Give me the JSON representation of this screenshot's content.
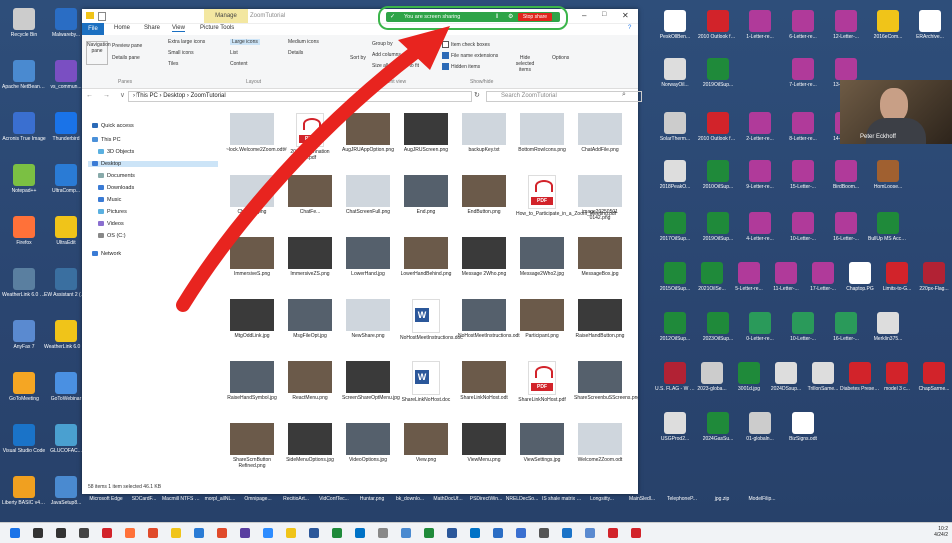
{
  "sharing": {
    "label": "You are screen sharing",
    "stop_label": "Stop share",
    "accent": "#2ea447",
    "stop_color": "#e1261c"
  },
  "webcam": {
    "name": "Peter Eckhoff"
  },
  "explorer": {
    "title": "ZoomTutorial",
    "manage_tab": "Manage",
    "tabs": [
      "File",
      "Home",
      "Share",
      "View",
      "Picture Tools"
    ],
    "ribbon": {
      "panes_items": [
        "Preview pane",
        "Details pane"
      ],
      "nav_pane": "Navigation pane",
      "layout_items": [
        "Extra large icons",
        "Large icons",
        "Medium icons",
        "Small icons",
        "List",
        "Details",
        "Tiles",
        "Content"
      ],
      "sort_by": "Sort by",
      "current_view_items": [
        "Group by",
        "Add columns",
        "Size all columns to fit"
      ],
      "checkboxes": [
        {
          "label": "Item check boxes",
          "checked": false
        },
        {
          "label": "File name extensions",
          "checked": true
        },
        {
          "label": "Hidden items",
          "checked": true
        }
      ],
      "hide_selected": "Hide selected items",
      "options": "Options",
      "groups": [
        "Panes",
        "Layout",
        "Current view",
        "Show/hide"
      ]
    },
    "address": "› This PC › Desktop › ZoomTutorial",
    "search_placeholder": "Search ZoomTutorial",
    "nav": [
      {
        "label": "Quick access",
        "color": "#2b6ab7"
      },
      {
        "label": "This PC",
        "color": "#4a90d9"
      },
      {
        "label": "3D Objects",
        "color": "#5ab0e0"
      },
      {
        "label": "Desktop",
        "color": "#3a7bd5",
        "selected": true
      },
      {
        "label": "Documents",
        "color": "#8aa"
      },
      {
        "label": "Downloads",
        "color": "#3a7bd5"
      },
      {
        "label": "Music",
        "color": "#3a7bd5"
      },
      {
        "label": "Pictures",
        "color": "#5ab0e0"
      },
      {
        "label": "Videos",
        "color": "#8a6fd0"
      },
      {
        "label": "OS (C:)",
        "color": "#888"
      },
      {
        "label": "Network",
        "color": "#3a7bd5"
      }
    ],
    "files": [
      {
        "name": "~lock.Welcome2Zoom.odt#",
        "kind": "light"
      },
      {
        "name": "2000-Zoomnation al.pdf",
        "kind": "pdf"
      },
      {
        "name": "AugJRUAppOption.png",
        "kind": "img"
      },
      {
        "name": "AugJRUScreen.png",
        "kind": "img"
      },
      {
        "name": "backupKey.txt",
        "kind": "light"
      },
      {
        "name": "BottomRowIcons.png",
        "kind": "light"
      },
      {
        "name": "ChatAddFile.png",
        "kind": "light"
      },
      {
        "name": "ChatBox.png",
        "kind": "light"
      },
      {
        "name": "ChatFe...",
        "kind": "img"
      },
      {
        "name": "ChatScreenFull.png",
        "kind": "light"
      },
      {
        "name": "End.png",
        "kind": "img"
      },
      {
        "name": "EndButton.png",
        "kind": "img"
      },
      {
        "name": "How_to_Participate_in_a_Zoom_Meeting.pdf",
        "kind": "pdf"
      },
      {
        "name": "image20250501 0142.png",
        "kind": "light"
      },
      {
        "name": "ImmersiveS.png",
        "kind": "img"
      },
      {
        "name": "ImmersiveZS.png",
        "kind": "img"
      },
      {
        "name": "LowerHand.jpg",
        "kind": "img"
      },
      {
        "name": "LowerHandBehind.png",
        "kind": "img"
      },
      {
        "name": "Message 2Who.png",
        "kind": "img"
      },
      {
        "name": "Message2Who2.jpg",
        "kind": "img"
      },
      {
        "name": "MessageBox.jpg",
        "kind": "img"
      },
      {
        "name": "MtgOddLink.jpg",
        "kind": "img"
      },
      {
        "name": "MsgFileOpt.jpg",
        "kind": "img"
      },
      {
        "name": "NewShare.png",
        "kind": "light"
      },
      {
        "name": "NoHostMeetInstructions.doc",
        "kind": "doc"
      },
      {
        "name": "NoHostMeetInstructions.odt",
        "kind": "img"
      },
      {
        "name": "Participant.png",
        "kind": "img"
      },
      {
        "name": "RaiseHandButton.png",
        "kind": "img"
      },
      {
        "name": "RaiseHandSymbol.jpg",
        "kind": "img"
      },
      {
        "name": "ReactMenu.png",
        "kind": "img"
      },
      {
        "name": "ScreenShareOptMenu.jpg",
        "kind": "img"
      },
      {
        "name": "ShareLinkNoHost.doc",
        "kind": "doc"
      },
      {
        "name": "ShareLinkNoHost.odt",
        "kind": "img"
      },
      {
        "name": "ShareLinkNoHost.pdf",
        "kind": "pdf"
      },
      {
        "name": "ShareScreenbuSScreens.png",
        "kind": "img"
      },
      {
        "name": "ShareScrnButton Refined.png",
        "kind": "img"
      },
      {
        "name": "SideMenuOptions.jpg",
        "kind": "img"
      },
      {
        "name": "VideoOptions.jpg",
        "kind": "img"
      },
      {
        "name": "View.png",
        "kind": "img"
      },
      {
        "name": "ViewMenu.png",
        "kind": "img"
      },
      {
        "name": "ViewSettings.jpg",
        "kind": "img"
      },
      {
        "name": "Welcome2Zoom.odt",
        "kind": "light"
      }
    ],
    "status": "58 items   1 item selected  46.1 KB"
  },
  "desktop_left": [
    {
      "label": "Recycle Bin",
      "color": "#ccc"
    },
    {
      "label": "Malwareby...",
      "color": "#2a6dc4"
    },
    {
      "label": "Apache NetBeans I...",
      "color": "#4a8ad0"
    },
    {
      "label": "vs_commun...",
      "color": "#7a4fc2"
    },
    {
      "label": "Acronis True Image",
      "color": "#3a6fd0"
    },
    {
      "label": "Thunderbird",
      "color": "#1a73e8"
    },
    {
      "label": "Notepad++",
      "color": "#7bc043"
    },
    {
      "label": "UltraComp...",
      "color": "#2a7bd5"
    },
    {
      "label": "Firefox",
      "color": "#ff7139"
    },
    {
      "label": "UltraEdit",
      "color": "#f0c419"
    },
    {
      "label": "WeatherLink 6.0 Lance",
      "color": "#5a7fa0"
    },
    {
      "label": "EW Assistant 2 (Lenovo...",
      "color": "#3a6fa0"
    },
    {
      "label": "AnyFax 7",
      "color": "#5a8ad0"
    },
    {
      "label": "WeatherLink 6.0 Dutton",
      "color": "#f0c419"
    },
    {
      "label": "GoToMeeting",
      "color": "#f5a623"
    },
    {
      "label": "GoToWebinar",
      "color": "#4a90e2"
    },
    {
      "label": "Visual Studio Code",
      "color": "#1a73c8"
    },
    {
      "label": "GLUCOFAC...",
      "color": "#4aa0d0"
    },
    {
      "label": "Liberty BASIC v4.5.1",
      "color": "#f0a020"
    },
    {
      "label": "JavaSetup8...",
      "color": "#4a8ad0"
    }
  ],
  "desktop_bottom": [
    "Microsoft Edge",
    "SDCardF...",
    "Macmill NTFS To...",
    "morpl_allNL...",
    "Omnipage...",
    "RecitioArt...",
    "VidConfTec...",
    "Huntar.png",
    "bk_downlo...",
    "MathDocUf...",
    "PSDirectWin...",
    "NRELDecSo...",
    "IS shale matrix 1.jpg",
    "Longsitty...",
    "MainSledl...",
    "TelephoneP...",
    "jpg.zip",
    "ModelFilip..."
  ],
  "desktop_right": [
    {
      "label": "PeskOllBen...",
      "color": "#fff"
    },
    {
      "label": "2010 Outlook for Energy...",
      "color": "#d2232a"
    },
    {
      "label": "1-Letter-re...",
      "color": "#b03a9a"
    },
    {
      "label": "6-Letter-re...",
      "color": "#b03a9a"
    },
    {
      "label": "12-Letter-...",
      "color": "#b03a9a"
    },
    {
      "label": "2016eCom...",
      "color": "#f0c419"
    },
    {
      "label": "ERArchive...",
      "color": "#fff"
    },
    {
      "label": "NorwayOil...",
      "color": "#ddd"
    },
    {
      "label": "2019OilSup...",
      "color": "#1f8a3a"
    },
    {
      "label": "7-Letter-re...",
      "color": "#b03a9a"
    },
    {
      "label": "13-Letter-...",
      "color": "#b03a9a"
    },
    {
      "label": "SolarTherm...",
      "color": "#ccc"
    },
    {
      "label": "2010 Outlook for Energy...",
      "color": "#d2232a"
    },
    {
      "label": "2-Letter-re...",
      "color": "#b03a9a"
    },
    {
      "label": "8-Letter-re...",
      "color": "#b03a9a"
    },
    {
      "label": "14-Letter-...",
      "color": "#b03a9a"
    },
    {
      "label": "2018PeakO...",
      "color": "#ddd"
    },
    {
      "label": "2010OilSup...",
      "color": "#1f8a3a"
    },
    {
      "label": "9-Letter-re...",
      "color": "#b03a9a"
    },
    {
      "label": "15-Letter-...",
      "color": "#b03a9a"
    },
    {
      "label": "BirdBoom...",
      "color": "#b03a9a"
    },
    {
      "label": "HomLoose...",
      "color": "#a06030"
    },
    {
      "label": "2017OilSup...",
      "color": "#1f8a3a"
    },
    {
      "label": "2019OilSup...",
      "color": "#1f8a3a"
    },
    {
      "label": "4-Letter-re...",
      "color": "#b03a9a"
    },
    {
      "label": "10-Letter-...",
      "color": "#b03a9a"
    },
    {
      "label": "16-Letter-...",
      "color": "#b03a9a"
    },
    {
      "label": "BullUp MS Accoul...",
      "color": "#1f8a3a"
    },
    {
      "label": "2015OilSup...",
      "color": "#1f8a3a"
    },
    {
      "label": "2021OilSe...",
      "color": "#1f8a3a"
    },
    {
      "label": "5-Letter-re...",
      "color": "#b03a9a"
    },
    {
      "label": "11-Letter-...",
      "color": "#b03a9a"
    },
    {
      "label": "17-Letter-...",
      "color": "#b03a9a"
    },
    {
      "label": "Chaptop.PG",
      "color": "#fff"
    },
    {
      "label": "Limits-to-G...",
      "color": "#d2232a"
    },
    {
      "label": "220px-Flag...",
      "color": "#b22234"
    },
    {
      "label": "2012OilSup...",
      "color": "#1f8a3a"
    },
    {
      "label": "2023OilSup...",
      "color": "#1f8a3a"
    },
    {
      "label": "0-Letter-re...",
      "color": "#2a9a5a"
    },
    {
      "label": "10-Letter-...",
      "color": "#2a9a5a"
    },
    {
      "label": "16-Letter-...",
      "color": "#2a9a5a"
    },
    {
      "label": "Merklin375...",
      "color": "#ddd"
    },
    {
      "label": "U.S. FLAG - W Pledge-...",
      "color": "#b22234"
    },
    {
      "label": "2023-globa...",
      "color": "#ccc"
    },
    {
      "label": "3001d.jpg",
      "color": "#1f8a3a"
    },
    {
      "label": "2024DSsup...",
      "color": "#ddd"
    },
    {
      "label": "TrillonSame...",
      "color": "#ddd"
    },
    {
      "label": "Diabetes Presentati...",
      "color": "#d2232a"
    },
    {
      "label": "model 3 c...",
      "color": "#d2232a"
    },
    {
      "label": "ChapSarme...",
      "color": "#d2232a"
    },
    {
      "label": "USGProd2...",
      "color": "#ddd"
    },
    {
      "label": "2024GasSu...",
      "color": "#1f8a3a"
    },
    {
      "label": "01-globaln...",
      "color": "#ccc"
    },
    {
      "label": "BizSigns.odt",
      "color": "#fff"
    }
  ],
  "taskbar": {
    "icons": [
      {
        "name": "windows-start-icon",
        "color": "#1a73e8"
      },
      {
        "name": "search-icon",
        "color": "#333"
      },
      {
        "name": "task-view-icon",
        "color": "#333"
      },
      {
        "name": "pen-icon",
        "color": "#444"
      },
      {
        "name": "acrobat-icon",
        "color": "#d2232a"
      },
      {
        "name": "firefox-icon",
        "color": "#ff7139"
      },
      {
        "name": "app-icon",
        "color": "#e04a2a"
      },
      {
        "name": "folder-icon",
        "color": "#f0c419"
      },
      {
        "name": "explorer-icon",
        "color": "#2a7bd5"
      },
      {
        "name": "chrome-icon",
        "color": "#e04a2a"
      },
      {
        "name": "store-icon",
        "color": "#5a3fa0"
      },
      {
        "name": "zoom-icon",
        "color": "#2d8cff"
      },
      {
        "name": "ultraedit-icon",
        "color": "#f0c419"
      },
      {
        "name": "word-icon",
        "color": "#2b579a"
      },
      {
        "name": "excel-icon",
        "color": "#1f8a3a"
      },
      {
        "name": "outlook-icon",
        "color": "#0072c6"
      },
      {
        "name": "app2-icon",
        "color": "#888"
      },
      {
        "name": "notes-icon",
        "color": "#4a8ad0"
      },
      {
        "name": "spreadsheet-icon",
        "color": "#1f8a3a"
      },
      {
        "name": "doc-icon",
        "color": "#2b579a"
      },
      {
        "name": "mail-icon",
        "color": "#0072c6"
      },
      {
        "name": "malwarebytes-icon",
        "color": "#2a6dc4"
      },
      {
        "name": "app3-icon",
        "color": "#3a6fd0"
      },
      {
        "name": "settings-icon",
        "color": "#555"
      },
      {
        "name": "edge-icon",
        "color": "#1a73c8"
      },
      {
        "name": "app4-icon",
        "color": "#5a8ad0"
      },
      {
        "name": "app5-icon",
        "color": "#d2232a"
      },
      {
        "name": "pdf-icon",
        "color": "#d2232a"
      }
    ],
    "time": "10:2",
    "date": "4/24/2"
  },
  "arrow_color": "#e8241f"
}
